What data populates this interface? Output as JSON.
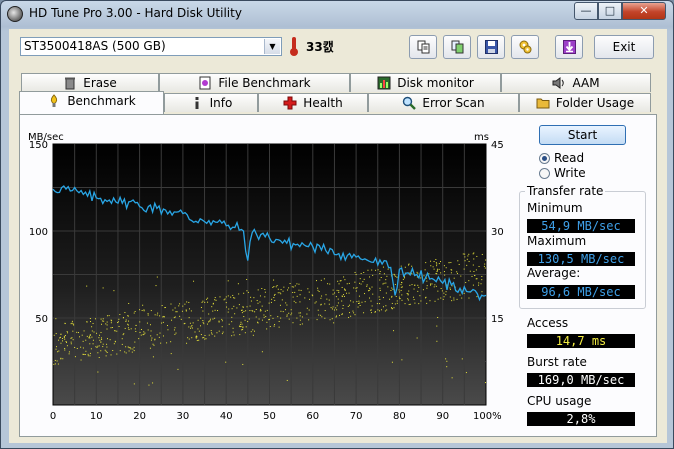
{
  "window": {
    "title": "HD Tune Pro 3.00 - Hard Disk Utility",
    "controls": {
      "minimize": "—",
      "maximize": "□",
      "close": "✕"
    }
  },
  "toolbar": {
    "drive": "ST3500418AS (500 GB)",
    "temperature": "33캜",
    "exit_label": "Exit",
    "buttons": [
      "copy-text-icon",
      "copy-screenshot-icon",
      "save-icon",
      "options-icon",
      "download-icon"
    ]
  },
  "tabs": {
    "top_row": [
      {
        "label": "Erase",
        "icon": "trash-icon"
      },
      {
        "label": "File Benchmark",
        "icon": "file-benchmark-icon"
      },
      {
        "label": "Disk monitor",
        "icon": "disk-monitor-icon"
      },
      {
        "label": "AAM",
        "icon": "speaker-icon"
      }
    ],
    "bottom_row": [
      {
        "label": "Benchmark",
        "icon": "benchmark-icon",
        "active": true
      },
      {
        "label": "Info",
        "icon": "info-icon"
      },
      {
        "label": "Health",
        "icon": "health-cross-icon"
      },
      {
        "label": "Error Scan",
        "icon": "magnifier-icon"
      },
      {
        "label": "Folder Usage",
        "icon": "folder-icon"
      }
    ]
  },
  "benchmark": {
    "start_label": "Start",
    "mode_options": [
      {
        "label": "Read",
        "selected": true
      },
      {
        "label": "Write",
        "selected": false
      }
    ],
    "transfer_rate_title": "Transfer rate",
    "minimum_label": "Minimum",
    "minimum_value": "54,9 MB/sec",
    "maximum_label": "Maximum",
    "maximum_value": "130,5 MB/sec",
    "average_label": "Average:",
    "average_value": "96,6 MB/sec",
    "access_label": "Access",
    "access_value": "14,7 ms",
    "burst_label": "Burst rate",
    "burst_value": "169,0 MB/sec",
    "cpu_label": "CPU usage",
    "cpu_value": "2,8%"
  },
  "chart_data": {
    "type": "line",
    "left_axis_label": "MB/sec",
    "right_axis_label": "ms",
    "left_ticks": [
      "150",
      "100",
      "50"
    ],
    "right_ticks": [
      "45",
      "30",
      "15"
    ],
    "x_ticks": [
      "0",
      "10",
      "20",
      "30",
      "40",
      "50",
      "60",
      "70",
      "80",
      "90",
      "100%"
    ],
    "xlim": [
      0,
      100
    ],
    "ylim": [
      0,
      150
    ],
    "y2lim": [
      0,
      45
    ],
    "grid": true,
    "colors": {
      "plot_bg": "#000000",
      "grid": "#3a3a3a",
      "transfer": "#29a6e6",
      "access": "#e8e43a"
    },
    "series": [
      {
        "role": "transfer",
        "x": [
          0,
          2,
          4,
          6,
          8,
          10,
          12,
          14,
          16,
          18,
          20,
          22,
          24,
          26,
          28,
          30,
          32,
          34,
          36,
          38,
          40,
          42,
          44,
          45,
          46,
          48,
          50,
          52,
          54,
          56,
          58,
          60,
          62,
          64,
          66,
          68,
          70,
          72,
          74,
          76,
          78,
          79,
          80,
          82,
          84,
          86,
          88,
          90,
          92,
          94,
          96,
          98,
          100
        ],
        "y": [
          124,
          125,
          123,
          122,
          120,
          119,
          118,
          119,
          116,
          117,
          114,
          114,
          113,
          112,
          111,
          110,
          106,
          107,
          106,
          105,
          103,
          102,
          100,
          83,
          99,
          98,
          96,
          95,
          93,
          92,
          92,
          91,
          89,
          90,
          87,
          86,
          85,
          84,
          82,
          81,
          79,
          63,
          78,
          76,
          75,
          73,
          72,
          70,
          69,
          67,
          65,
          64,
          63
        ]
      }
    ],
    "access_times_ms": {
      "x_range": [
        0,
        100
      ],
      "low_start": 7,
      "low_end": 19,
      "high_start": 14,
      "high_end": 27,
      "count": 900
    }
  }
}
